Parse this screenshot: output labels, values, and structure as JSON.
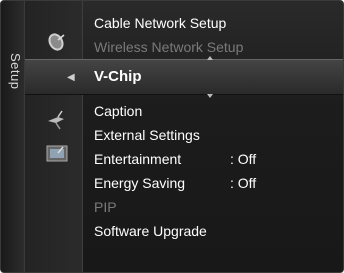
{
  "side": {
    "label": "Setup"
  },
  "top_items": [
    {
      "label": "Cable Network Setup"
    },
    {
      "label": "Wireless Network Setup"
    }
  ],
  "selected": {
    "label": "V-Chip"
  },
  "items": [
    {
      "label": "Caption",
      "value": ""
    },
    {
      "label": "External Settings",
      "value": ""
    },
    {
      "label": "Entertainment",
      "value": ": Off"
    },
    {
      "label": "Energy Saving",
      "value": ": Off"
    },
    {
      "label": "PIP",
      "value": ""
    },
    {
      "label": "Software Upgrade",
      "value": ""
    }
  ],
  "icons": [
    "satellite-dish-icon",
    "gear-icon",
    "antenna-icon",
    "picture-icon"
  ],
  "colors": {
    "background": "#1c1c1c",
    "text": "#ffffff",
    "disabled": "#7a7a7a"
  }
}
